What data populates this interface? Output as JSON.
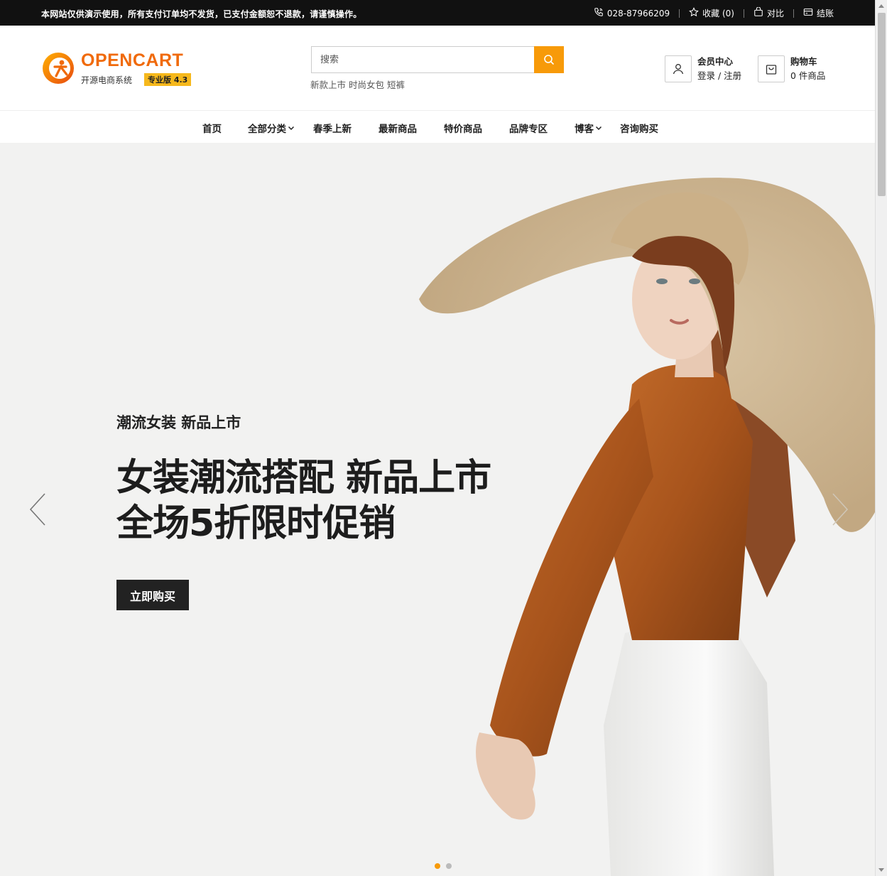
{
  "topbar": {
    "notice": "本网站仅供演示使用，所有支付订单均不发货，已支付金额恕不退款，请谨慎操作。",
    "phone": "028-87966209",
    "wishlist": "收藏 (0)",
    "compare": "对比",
    "checkout": "结账"
  },
  "logo": {
    "brand": "OPENCART",
    "subtitle": "开源电商系统",
    "version": "专业版 4.3"
  },
  "search": {
    "placeholder": "搜索",
    "hotwords": [
      "新款上市",
      "时尚女包",
      "短裤"
    ]
  },
  "account": {
    "title": "会员中心",
    "links": "登录 / 注册"
  },
  "cart": {
    "title": "购物车",
    "count": "0 件商品"
  },
  "nav": {
    "items": [
      "首页",
      "全部分类",
      "春季上新",
      "最新商品",
      "特价商品",
      "品牌专区",
      "博客",
      "咨询购买"
    ]
  },
  "hero": {
    "subhead": "潮流女装 新品上市",
    "headline_line1": "女装潮流搭配 新品上市",
    "headline_line2": "全场5折限时促销",
    "cta": "立即购买",
    "slide_count": 2,
    "active_slide": 1
  },
  "colors": {
    "accent": "#f79a09",
    "brand": "#f06a0b",
    "topbar_bg": "#111111",
    "hero_bg": "#f2f2f1"
  }
}
